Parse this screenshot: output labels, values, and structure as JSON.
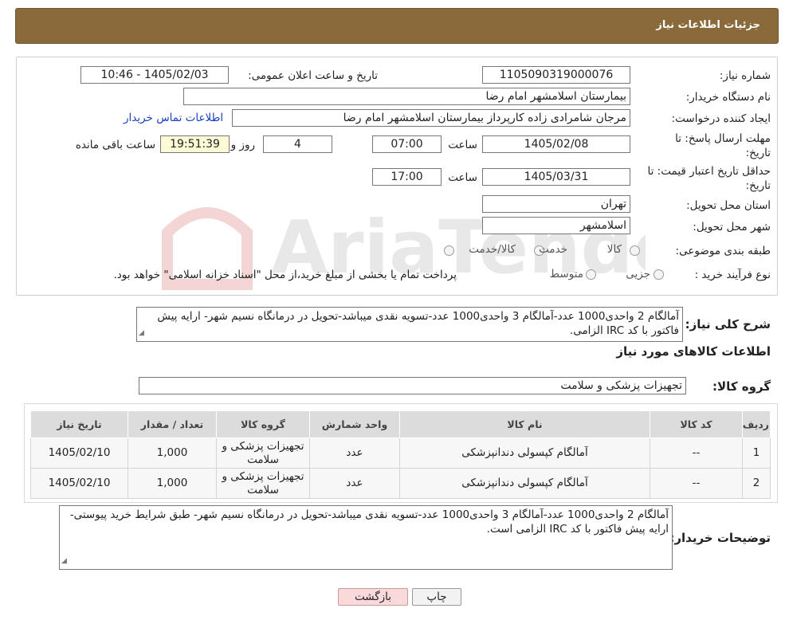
{
  "header": {
    "title": "جزئیات اطلاعات نیاز"
  },
  "form": {
    "need_number_label": "شماره نیاز:",
    "need_number": "1105090319000076",
    "announce_label": "تاریخ و ساعت اعلان عمومی:",
    "announce_value": "1405/02/03 - 10:46",
    "buyer_org_label": "نام دستگاه خریدار:",
    "buyer_org": "بیمارستان اسلامشهر   امام رضا",
    "creator_label": "ایجاد کننده درخواست:",
    "creator": "مرجان شامرادی زاده کارپرداز بیمارستان اسلامشهر   امام رضا",
    "contact_link": "اطلاعات تماس خریدار",
    "deadline_label": "مهلت ارسال پاسخ: تا تاریخ:",
    "deadline_date": "1405/02/08",
    "time_label": "ساعت",
    "deadline_time": "07:00",
    "days_value": "4",
    "days_label": "روز و",
    "remaining_time": "19:51:39",
    "remaining_label": "ساعت باقی مانده",
    "validity_label": "حداقل تاریخ اعتبار قیمت: تا تاریخ:",
    "validity_date": "1405/03/31",
    "validity_time": "17:00",
    "province_label": "استان محل تحویل:",
    "province": "تهران",
    "city_label": "شهر محل تحویل:",
    "city": "اسلامشهر",
    "category_label": "طبقه بندی موضوعی:",
    "category_options": [
      "کالا",
      "خدمت",
      "کالا/خدمت"
    ],
    "purchase_type_label": "نوع فرآیند خرید :",
    "purchase_options": [
      "جزیی",
      "متوسط"
    ],
    "purchase_note": "پرداخت تمام یا بخشی از مبلغ خرید،از محل \"اسناد خزانه اسلامی\" خواهد بود."
  },
  "summary": {
    "label": "شرح کلی نیاز:",
    "text": "آمالگام 2 واحدی1000 عدد-آمالگام 3 واحدی1000 عدد-تسویه نقدی میباشد-تحویل در درمانگاه نسیم شهر- ارایه پیش فاکتور با کد IRC الزامی."
  },
  "goods": {
    "section_title": "اطلاعات کالاهای مورد نیاز",
    "group_label": "گروه کالا:",
    "group_value": "تجهیزات پزشکی و سلامت",
    "columns": [
      "ردیف",
      "کد کالا",
      "نام کالا",
      "واحد شمارش",
      "گروه کالا",
      "تعداد / مقدار",
      "تاریخ نیاز"
    ],
    "rows": [
      [
        "1",
        "--",
        "آمالگام کپسولی دندانپزشکی",
        "عدد",
        "تجهیزات پزشکی و سلامت",
        "1,000",
        "1405/02/10"
      ],
      [
        "2",
        "--",
        "آمالگام کپسولی دندانپزشکی",
        "عدد",
        "تجهیزات پزشکی و سلامت",
        "1,000",
        "1405/02/10"
      ]
    ]
  },
  "buyer_notes": {
    "label": "توضیحات خریدار:",
    "text": "آمالگام 2 واحدی1000 عدد-آمالگام 3 واحدی1000 عدد-تسویه نقدی میباشد-تحویل در درمانگاه نسیم شهر- طبق شرایط خرید پیوستی- ارایه پیش فاکتور با کد IRC الزامی است."
  },
  "buttons": {
    "print": "چاپ",
    "back": "بازگشت"
  },
  "watermark": {
    "text": "AriaTender.neT"
  },
  "colors": {
    "header_bg": "#8a6a3a",
    "link": "#1a3fbf",
    "back_button_bg": "#f9d9d9"
  }
}
